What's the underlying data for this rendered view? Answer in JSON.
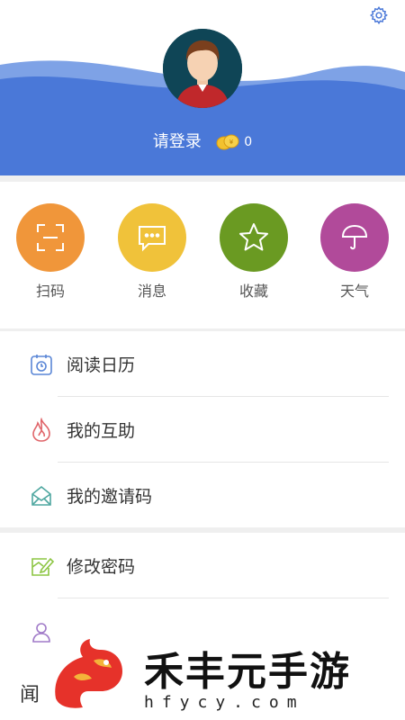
{
  "header": {
    "login_label": "请登录",
    "coin_count": "0",
    "colors": {
      "wave": "#4a78d8",
      "wave_light": "#7ea2e6"
    },
    "settings_icon": "gear-icon",
    "avatar_icon": "user-avatar"
  },
  "shortcuts": [
    {
      "label": "扫码",
      "icon": "scan-icon",
      "color": "#f0963a"
    },
    {
      "label": "消息",
      "icon": "message-icon",
      "color": "#f0c23a"
    },
    {
      "label": "收藏",
      "icon": "star-icon",
      "color": "#6a9a22"
    },
    {
      "label": "天气",
      "icon": "umbrella-icon",
      "color": "#b14a9a"
    }
  ],
  "menu_a": [
    {
      "label": "阅读日历",
      "icon": "calendar-icon"
    },
    {
      "label": "我的互助",
      "icon": "flame-icon"
    },
    {
      "label": "我的邀请码",
      "icon": "invite-envelope-icon"
    }
  ],
  "menu_b": [
    {
      "label": "修改密码",
      "icon": "edit-password-icon"
    },
    {
      "label": "",
      "icon": "user-icon"
    }
  ],
  "watermark": {
    "left_char": "闻",
    "brand": "禾丰元手游",
    "url": "hfycy.com"
  }
}
